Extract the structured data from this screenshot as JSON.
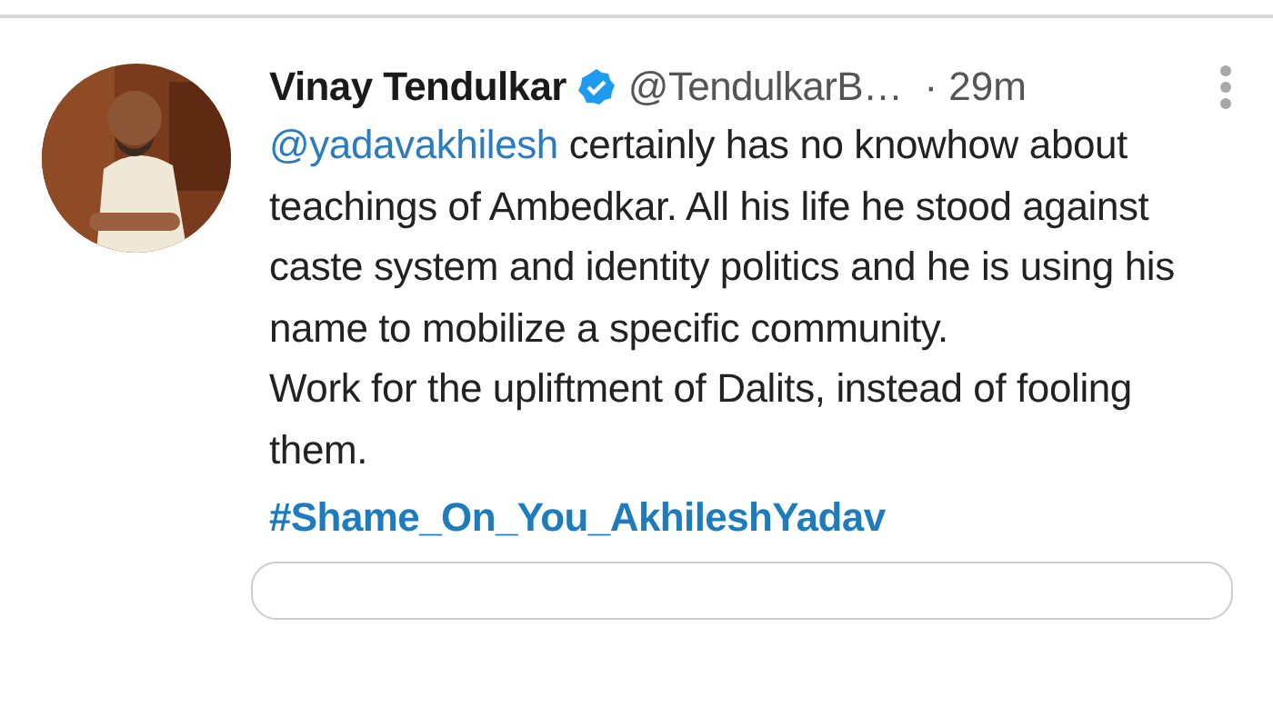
{
  "tweet": {
    "author": {
      "name": "Vinay Tendulkar",
      "verified": true,
      "handle": "@TendulkarB…",
      "time": "· 29m"
    },
    "paragraphs": [
      {
        "mention": "@yadavakhilesh",
        "text": " certainly has no knowhow about teachings of Ambedkar. All his life he stood against caste system and identity politics and he is using his name to mobilize a specific community."
      },
      {
        "text": "Work for the upliftment of Dalits, instead of fooling them."
      }
    ],
    "hashtag": "#Shame_On_You_AkhileshYadav"
  }
}
